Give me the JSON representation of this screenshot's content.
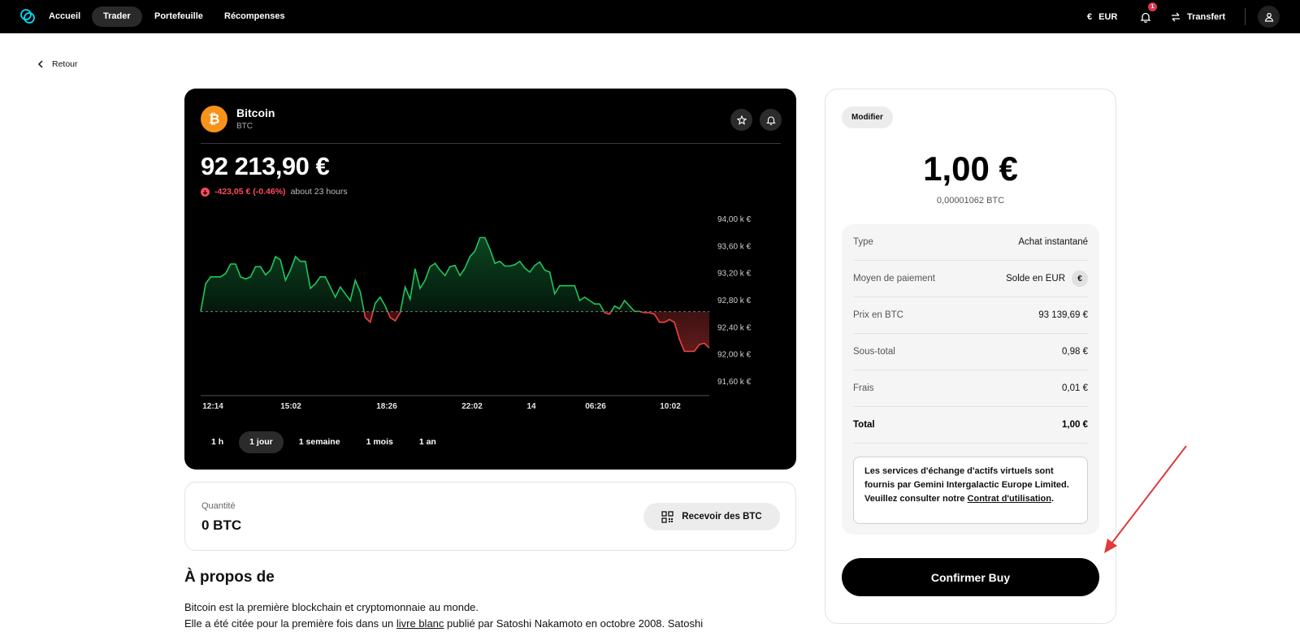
{
  "nav": {
    "links": [
      "Accueil",
      "Trader",
      "Portefeuille",
      "Récompenses"
    ],
    "currency": "EUR",
    "notification_count": "1",
    "transfer": "Transfert"
  },
  "back_label": "Retour",
  "asset": {
    "name": "Bitcoin",
    "symbol": "BTC",
    "price": "92 213,90 €",
    "change": "-423,05 € (-0.46%)",
    "change_period": "about 23 hours"
  },
  "range_tabs": [
    "1 h",
    "1 jour",
    "1 semaine",
    "1 mois",
    "1 an"
  ],
  "active_range": "1 jour",
  "chart_data": {
    "type": "line",
    "y_tick_labels": [
      "94,00 k €",
      "93,60 k €",
      "93,20 k €",
      "92,80 k €",
      "92,40 k €",
      "92,00 k €",
      "91,60 k €"
    ],
    "x_tick_labels": [
      "12:14",
      "15:02",
      "18:26",
      "22:02",
      "14",
      "06:26",
      "10:02"
    ],
    "ylim": [
      91600,
      94000
    ],
    "baseline": 92637,
    "y_values": [
      92640,
      93050,
      93150,
      93150,
      93150,
      93200,
      93340,
      93340,
      93150,
      93120,
      93150,
      93300,
      93300,
      93180,
      93250,
      93450,
      93400,
      93100,
      93250,
      93450,
      93380,
      93380,
      92980,
      93050,
      93150,
      93150,
      93000,
      92850,
      93000,
      92900,
      92800,
      93100,
      92930,
      92550,
      92480,
      92760,
      92850,
      92720,
      92550,
      92500,
      92620,
      93000,
      92820,
      93270,
      92980,
      93100,
      93300,
      93350,
      93250,
      93170,
      93300,
      93320,
      93170,
      93280,
      93450,
      93530,
      93730,
      93730,
      93560,
      93350,
      93380,
      93310,
      93310,
      93330,
      93380,
      93280,
      93220,
      93320,
      93370,
      93250,
      93220,
      92900,
      93020,
      93020,
      93020,
      93020,
      92800,
      92850,
      92800,
      92750,
      92750,
      92620,
      92600,
      92720,
      92680,
      92800,
      92720,
      92640,
      92640,
      92620,
      92620,
      92600,
      92480,
      92480,
      92520,
      92480,
      92230,
      92050,
      92050,
      92050,
      92150,
      92170,
      92100
    ],
    "colors": {
      "up": "#22c55e",
      "down": "#ef4444"
    }
  },
  "quantity": {
    "label": "Quantité",
    "value": "0 BTC",
    "receive_label": "Recevoir des BTC"
  },
  "about": {
    "title": "À propos de",
    "line1": "Bitcoin est la première blockchain et cryptomonnaie au monde.",
    "line2_pre": "Elle a été citée pour la première fois dans un ",
    "line2_link": "livre blanc",
    "line2_post": " publié par Satoshi Nakamoto en octobre 2008. Satoshi"
  },
  "order": {
    "modify_label": "Modifier",
    "amount": "1,00 €",
    "amount_btc": "0,00001062 BTC",
    "rows": [
      {
        "label": "Type",
        "value": "Achat instantané"
      },
      {
        "label": "Moyen de paiement",
        "value": "Solde en EUR"
      },
      {
        "label": "Prix en BTC",
        "value": "93 139,69 €"
      },
      {
        "label": "Sous-total",
        "value": "0,98 €"
      },
      {
        "label": "Frais",
        "value": "0,01 €"
      },
      {
        "label": "Total",
        "value": "1,00 €"
      }
    ],
    "payment_chip": "€",
    "notice_pre": "Les services d'échange d'actifs virtuels sont fournis par Gemini Intergalactic Europe Limited. Veuillez consulter notre ",
    "notice_link": "Contrat d'utilisation",
    "notice_post": ".",
    "confirm_label": "Confirmer Buy"
  }
}
